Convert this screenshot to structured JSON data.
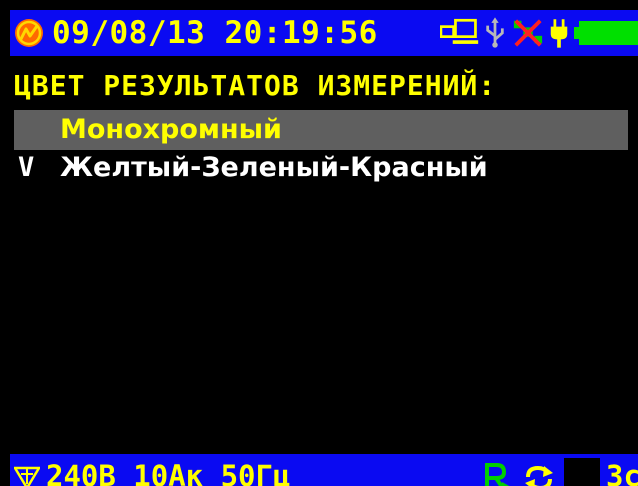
{
  "status_bar": {
    "datetime": "09/08/13 20:19:56",
    "icons": [
      "brand-logo-icon",
      "pc-connection-icon",
      "usb-icon",
      "no-satellite-icon",
      "power-plug-icon",
      "battery-icon"
    ]
  },
  "menu": {
    "title": "ЦВЕТ РЕЗУЛЬТАТОВ ИЗМЕРЕНИЙ:",
    "items": [
      {
        "check": "",
        "label": "Монохромный",
        "selected": true
      },
      {
        "check": "V",
        "label": "Желтый-Зеленый-Красный",
        "selected": false
      }
    ]
  },
  "bottom_bar": {
    "ranges": "240В 10Ак 50Гц",
    "interval": "3с",
    "icons": [
      "filter-icon",
      "recording-icon",
      "refresh-icon"
    ]
  },
  "colors": {
    "bar_background": "#0a0af2",
    "text_yellow": "#ffff00",
    "selection": "#5f5f5f",
    "logo_orange": "#ff6a00",
    "usb_gray": "#b8b8b8",
    "battery_green": "#00e000",
    "rec_green": "#00d000"
  }
}
